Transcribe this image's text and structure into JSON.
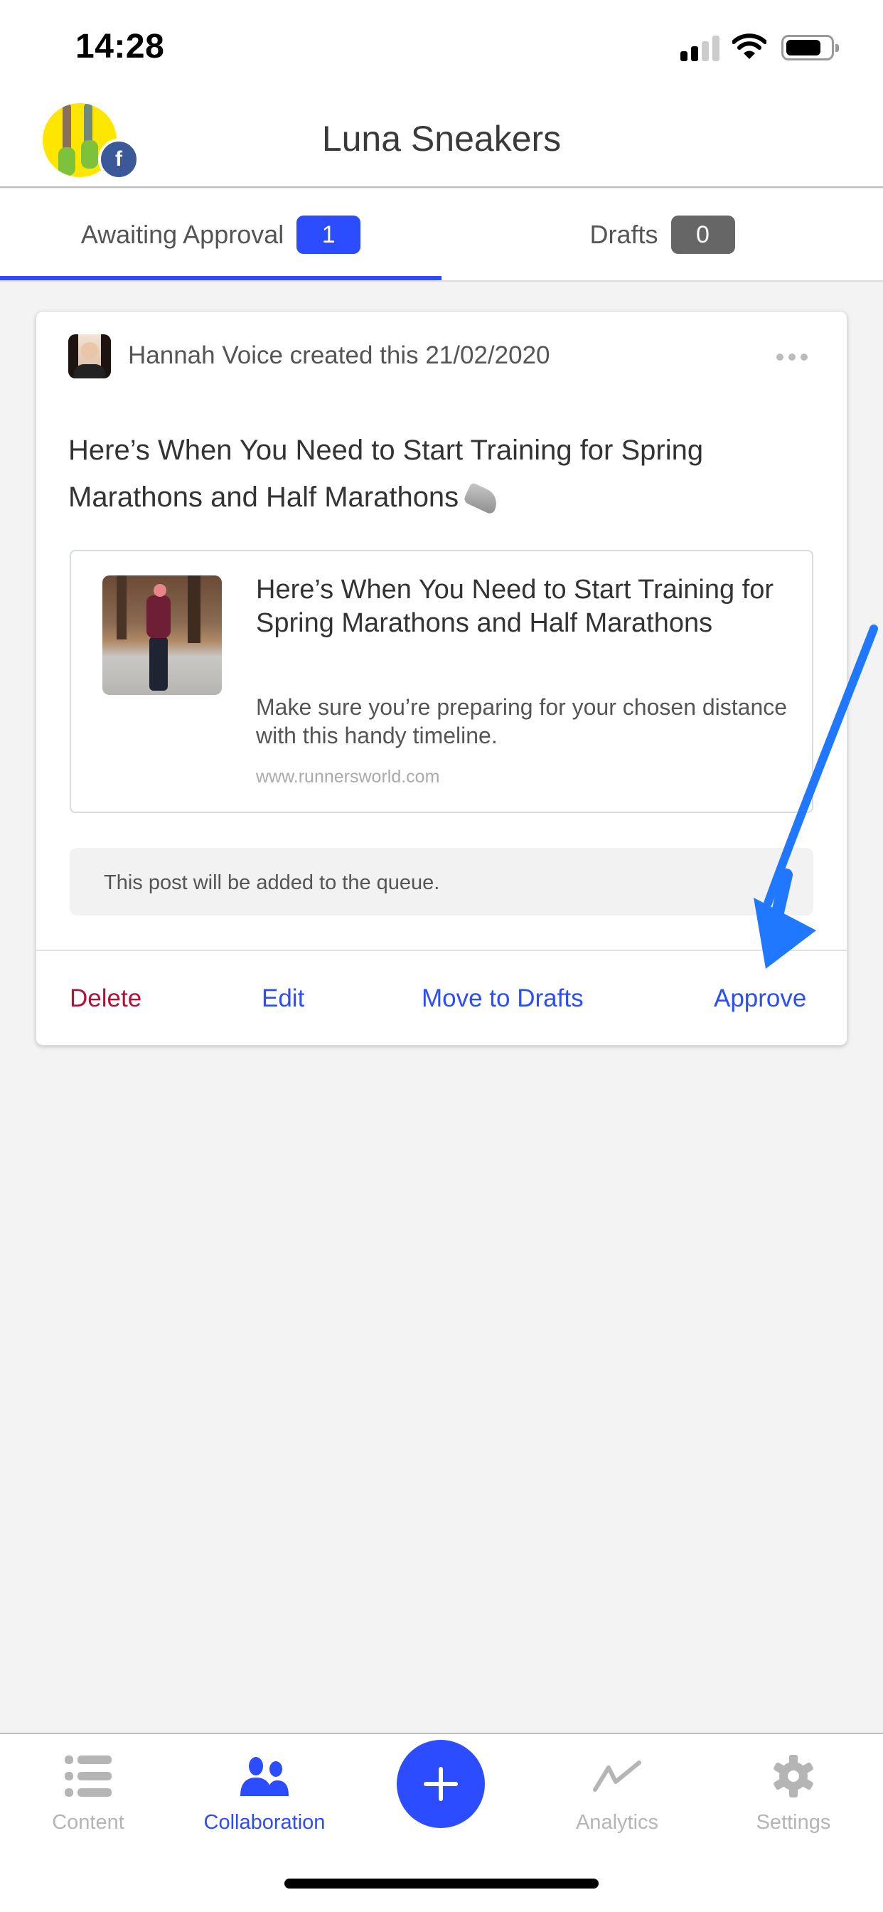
{
  "status_bar": {
    "time": "14:28",
    "signal_bars_filled": 2,
    "signal_bars_total": 4,
    "wifi_icon": "wifi-icon",
    "battery_level_percent": 80
  },
  "header": {
    "title": "Luna Sneakers",
    "avatar_icon": "page-avatar",
    "network_badge_icon": "facebook-icon",
    "network_badge_glyph": "f"
  },
  "tabs": [
    {
      "label": "Awaiting Approval",
      "count": "1",
      "active": true,
      "badge_color": "#2b4cff"
    },
    {
      "label": "Drafts",
      "count": "0",
      "active": false,
      "badge_color": "#666666"
    }
  ],
  "post": {
    "author_line": "Hannah Voice created this 21/02/2020",
    "more_icon": "more-horizontal-icon",
    "text": "Here’s When You Need to Start Training for Spring Marathons and Half Marathons",
    "emoji_icon": "running-shoe-icon",
    "link_preview": {
      "title": "Here’s When You Need to Start Training for Spring Marathons and Half Marathons",
      "description": "Make sure you’re preparing for your chosen distance with this handy timeline.",
      "domain": "www.runnersworld.com"
    },
    "notice": "This post will be added to the queue.",
    "actions": {
      "delete": "Delete",
      "edit": "Edit",
      "move_to_drafts": "Move to Drafts",
      "approve": "Approve"
    }
  },
  "bottom_nav": {
    "items": [
      {
        "label": "Content",
        "icon": "list-icon",
        "active": false
      },
      {
        "label": "Collaboration",
        "icon": "people-icon",
        "active": true
      },
      {
        "label": "Analytics",
        "icon": "trend-line-icon",
        "active": false
      },
      {
        "label": "Settings",
        "icon": "gear-icon",
        "active": false
      }
    ],
    "fab_icon": "plus-icon"
  },
  "colors": {
    "accent": "#2b4cff",
    "delete": "#b0123a",
    "inactive_nav": "#b5b5b5",
    "annotation_arrow": "#1f78ff",
    "background": "#f3f3f3"
  }
}
